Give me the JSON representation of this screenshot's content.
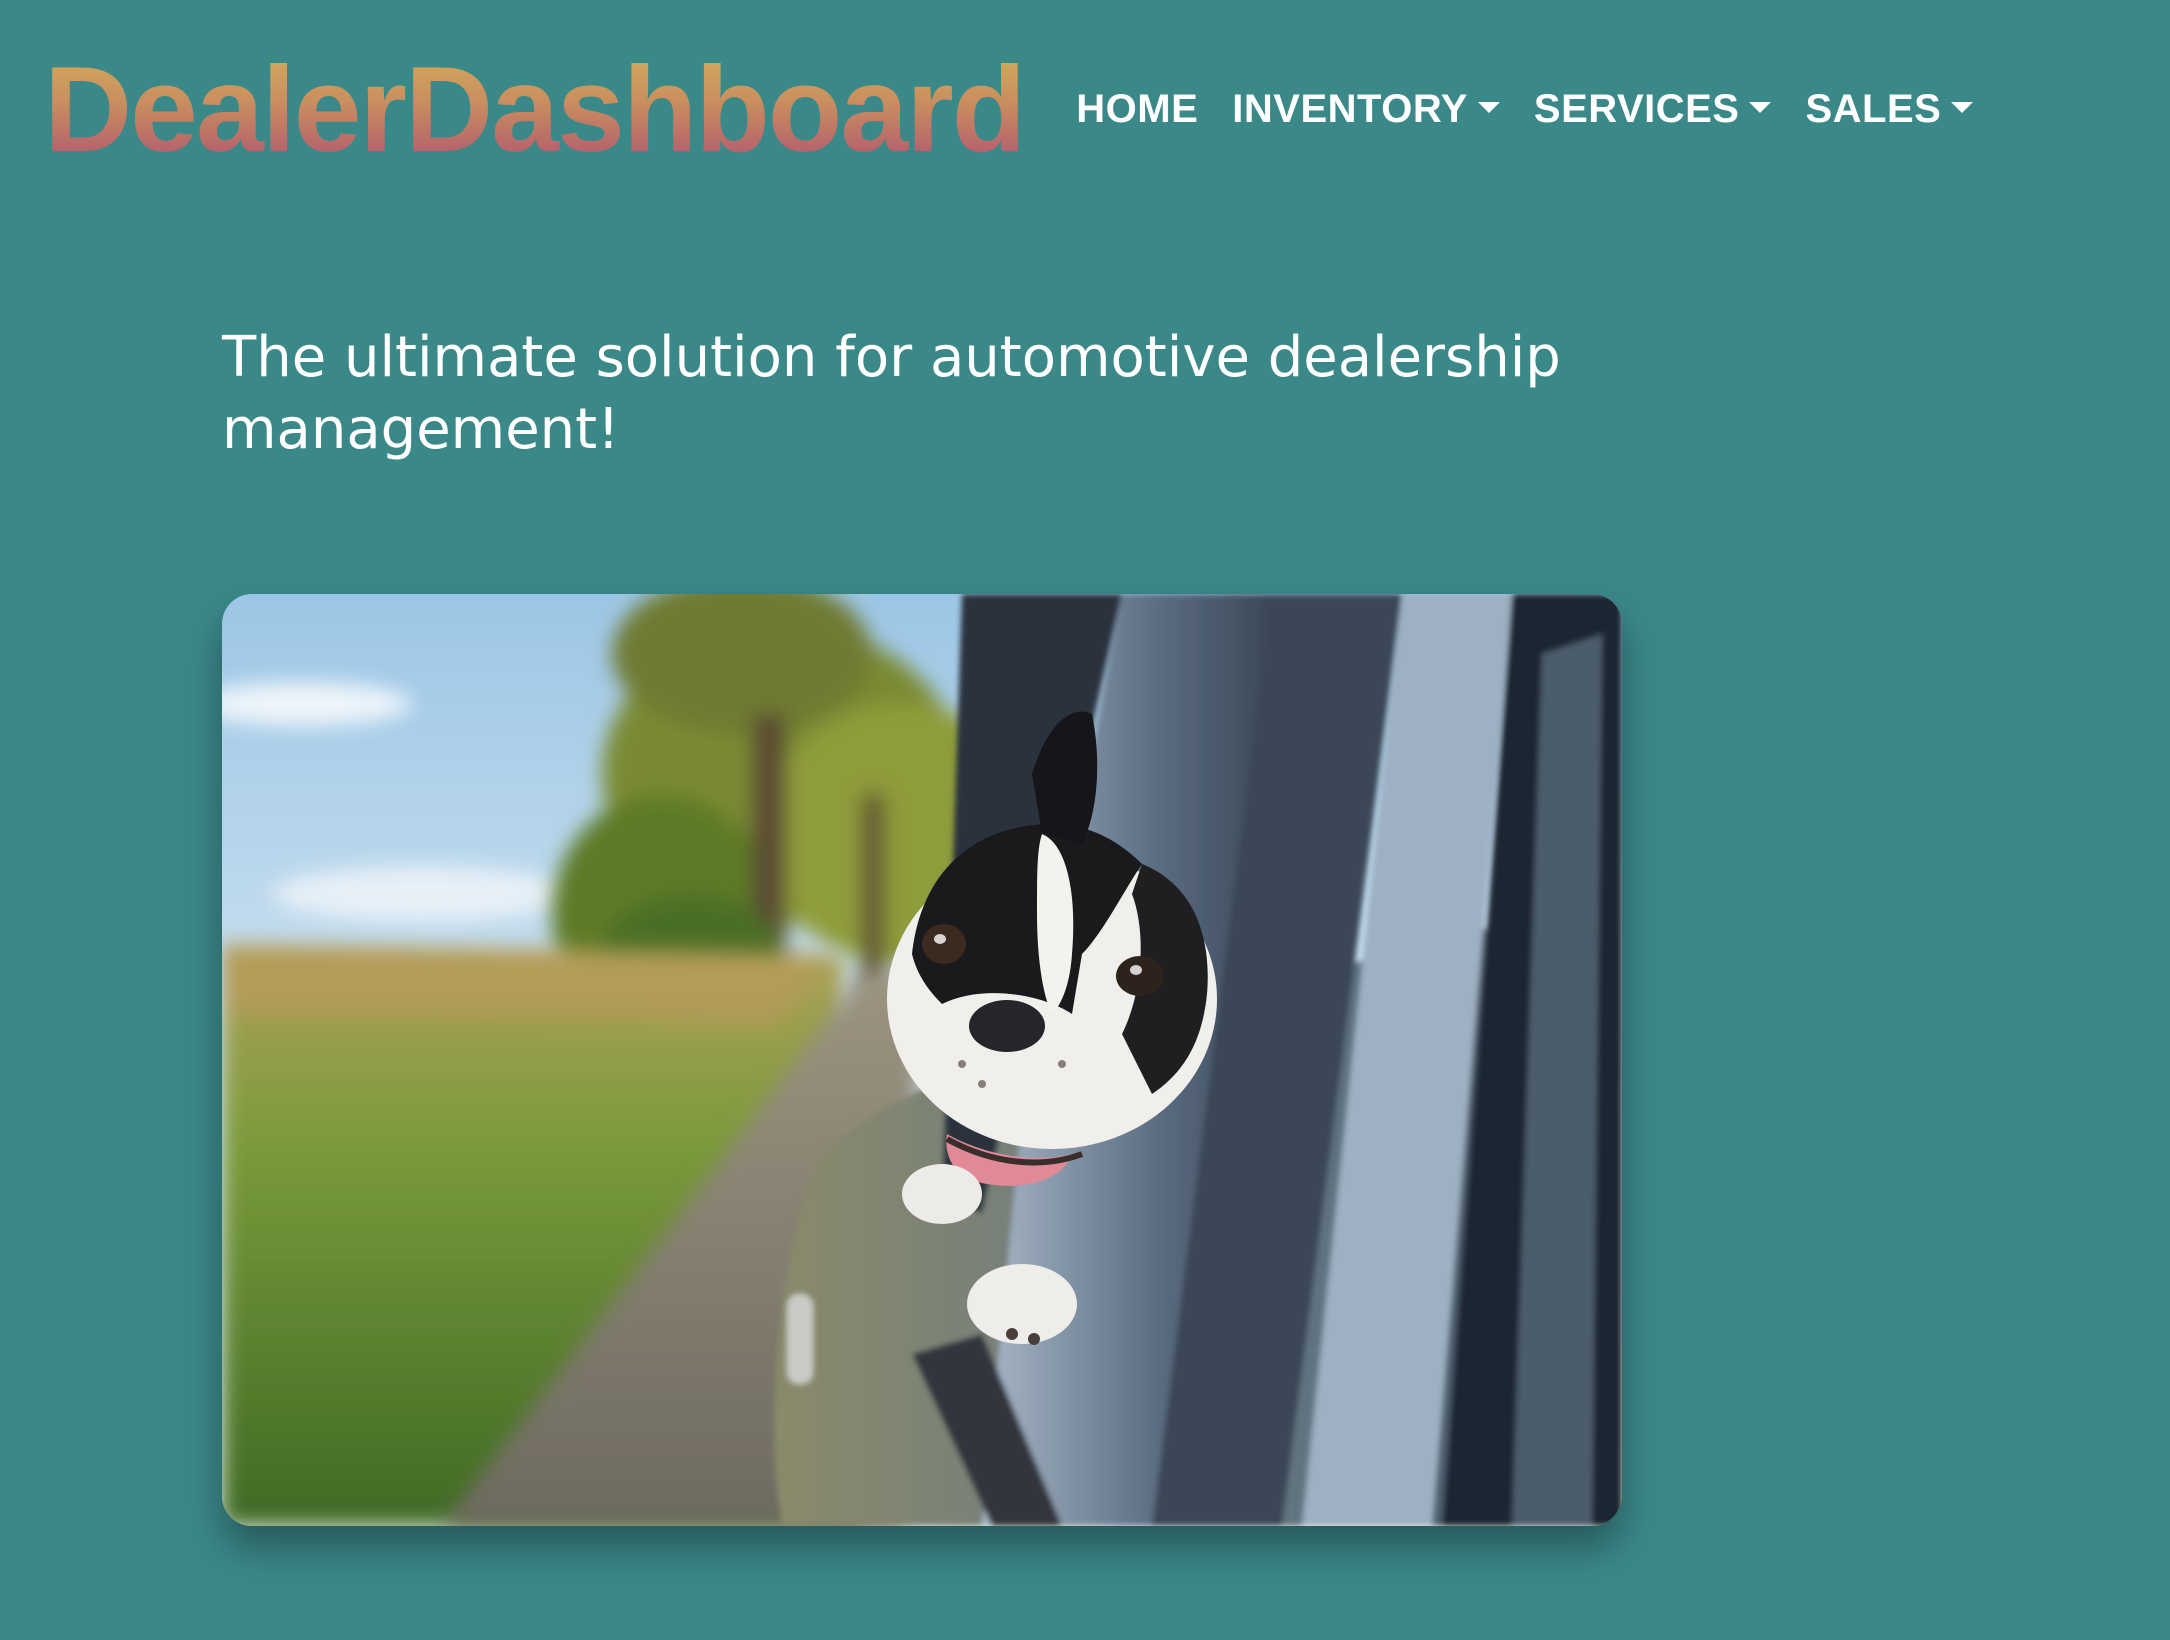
{
  "header": {
    "brand": "DealerDashboard",
    "nav": [
      {
        "label": "HOME",
        "dropdown": false
      },
      {
        "label": "INVENTORY",
        "dropdown": true
      },
      {
        "label": "SERVICES",
        "dropdown": true
      },
      {
        "label": "SALES",
        "dropdown": true
      }
    ]
  },
  "hero": {
    "tagline": "The ultimate solution for automotive dealership management!",
    "image": "photo of a black and white dog leaning out of a car window on a country road"
  },
  "colors": {
    "background": "#3b8889",
    "brand_gradient_top": "#d3b05a",
    "brand_gradient_bottom": "#ad4f72",
    "nav_text": "#ffffff"
  }
}
